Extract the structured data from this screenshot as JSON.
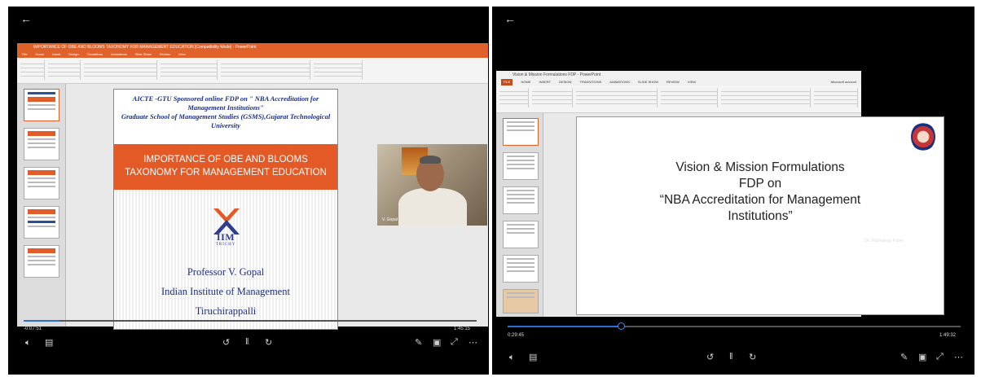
{
  "left_panel": {
    "ppt_title": "IMPORTANCE OF OBE AND BLOOMS TAXONOMY FOR MANAGEMENT EDUCATION [Compatibility Mode] - PowerPoint",
    "ribbon_tabs": [
      "File",
      "Home",
      "Insert",
      "Design",
      "Transitions",
      "Animations",
      "Slide Show",
      "Review",
      "View"
    ],
    "slide": {
      "header_line1": "AICTE -GTU Sponsored online FDP on \" NBA Accreditation for",
      "header_line2": "Management Institutions\"",
      "header_line3": "Graduate School of Management Studies (GSMS),Gujarat Technological",
      "header_line4": "University",
      "band_line1": "IMPORTANCE OF OBE AND BLOOMS",
      "band_line2": "TAXONOMY FOR MANAGEMENT EDUCATION",
      "logo_text": "IIM",
      "logo_sub": "TRICHY",
      "presenter": "Professor V. Gopal",
      "institute": "Indian Institute of Management",
      "city": "Tiruchirappalli"
    },
    "webcam_name": "V. Gopal",
    "time_elapsed": "-0:07:51",
    "time_total": "1:45:15",
    "progress_fraction": 0.08
  },
  "right_panel": {
    "ppt_title": "Vision & Mission Formulations FDP - PowerPoint",
    "ribbon_tabs": [
      "FILE",
      "HOME",
      "INSERT",
      "DESIGN",
      "TRANSITIONS",
      "ANIMATIONS",
      "SLIDE SHOW",
      "REVIEW",
      "VIEW"
    ],
    "account": "Microsoft account",
    "slide": {
      "line1": "Vision & Mission Formulations",
      "line2": "FDP on",
      "line3": "“NBA Accreditation for Management",
      "line4": "Institutions”"
    },
    "speaker_name": "Dr. Pankajray Patel",
    "time_elapsed": "0:29:45",
    "time_total": "1:49:32",
    "progress_fraction": 0.25
  },
  "icons": {
    "back": "back-arrow-icon",
    "volume": "volume-icon",
    "captions": "captions-icon",
    "rewind": "rewind-icon",
    "pause": "pause-icon",
    "forward": "forward-icon",
    "pen": "pen-icon",
    "miniplayer": "miniplayer-icon",
    "fullscreen": "expand-icon",
    "more": "more-icon"
  },
  "colors": {
    "band_orange": "#e45a26",
    "ppt_titlebar_left": "#e0622a",
    "ppt_titlebar_right": "#c44b1e",
    "progress_blue": "#2b6fd6",
    "slide_blue_text": "#1a2f8a"
  }
}
